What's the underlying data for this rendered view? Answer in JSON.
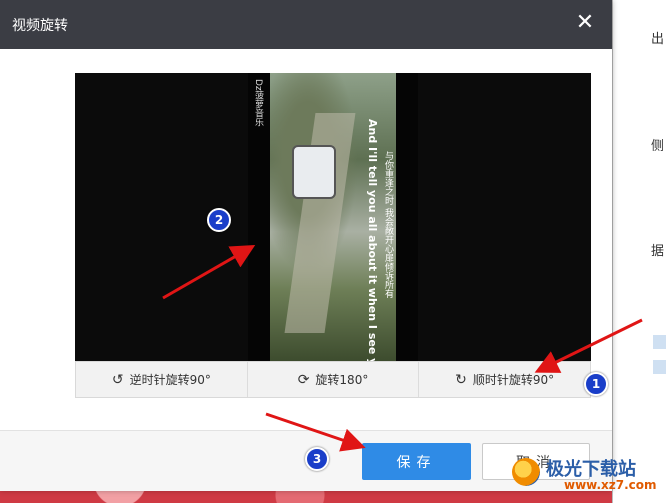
{
  "dialog": {
    "title": "视频旋转",
    "close_icon": "close-icon"
  },
  "preview": {
    "channel_logo": "Dz菠萝音乐",
    "subtitle_line1": "And I'll tell you all about it when I see you again",
    "subtitle_line2": "与你重逢之时 我会敞开心扉倾诉所有"
  },
  "rotate_bar": {
    "counterclockwise_label": "逆时针旋转90°",
    "rotate180_label": "旋转180°",
    "clockwise_label": "顺时针旋转90°",
    "counterclockwise_icon": "rotate-left-icon",
    "rotate180_icon": "refresh-icon",
    "clockwise_icon": "rotate-right-icon"
  },
  "footer": {
    "save_label": "保存",
    "cancel_label": "取消"
  },
  "annotations": {
    "badge1": "1",
    "badge2": "2",
    "badge3": "3",
    "arrow_color": "#e01515",
    "badge_color": "#1a3ec9"
  },
  "background_window": {
    "text1": "出",
    "text2": "侧",
    "text3": "据"
  },
  "watermark": {
    "text": "极光下载站",
    "url": "www.xz7.com"
  },
  "colors": {
    "titlebar": "#3b3d44",
    "save_button": "#2f8be6"
  }
}
